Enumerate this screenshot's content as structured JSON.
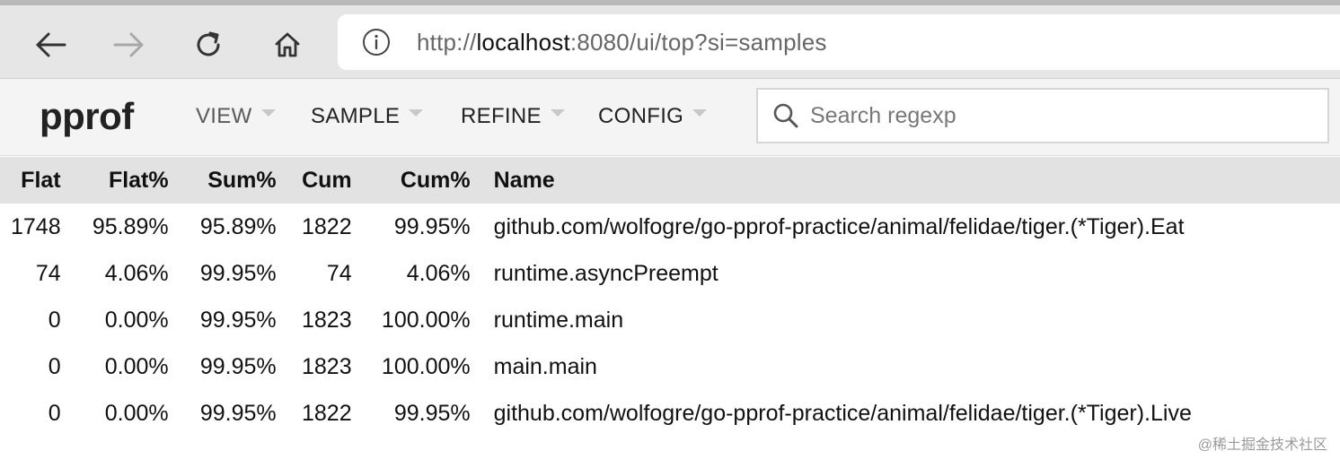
{
  "browser": {
    "back_icon": "arrow-left-icon",
    "forward_icon": "arrow-right-icon",
    "reload_icon": "reload-icon",
    "home_icon": "home-icon",
    "info_icon": "info-icon",
    "url_scheme": "http://",
    "url_host": "localhost",
    "url_rest": ":8080/ui/top?si=samples"
  },
  "header": {
    "logo": "pprof",
    "menus": [
      "VIEW",
      "SAMPLE",
      "REFINE",
      "CONFIG"
    ],
    "search_placeholder": "Search regexp"
  },
  "table": {
    "columns": [
      "Flat",
      "Flat%",
      "Sum%",
      "Cum",
      "Cum%",
      "Name"
    ],
    "rows": [
      [
        "1748",
        "95.89%",
        "95.89%",
        "1822",
        "99.95%",
        "github.com/wolfogre/go-pprof-practice/animal/felidae/tiger.(*Tiger).Eat"
      ],
      [
        "74",
        "4.06%",
        "99.95%",
        "74",
        "4.06%",
        "runtime.asyncPreempt"
      ],
      [
        "0",
        "0.00%",
        "99.95%",
        "1823",
        "100.00%",
        "runtime.main"
      ],
      [
        "0",
        "0.00%",
        "99.95%",
        "1823",
        "100.00%",
        "main.main"
      ],
      [
        "0",
        "0.00%",
        "99.95%",
        "1822",
        "99.95%",
        "github.com/wolfogre/go-pprof-practice/animal/felidae/tiger.(*Tiger).Live"
      ]
    ]
  },
  "watermark": "@稀土掘金技术社区",
  "colors": {
    "browser_bar": "#e6e6e6",
    "header_bg": "#f4f4f4",
    "table_header_bg": "#e2e2e2"
  }
}
